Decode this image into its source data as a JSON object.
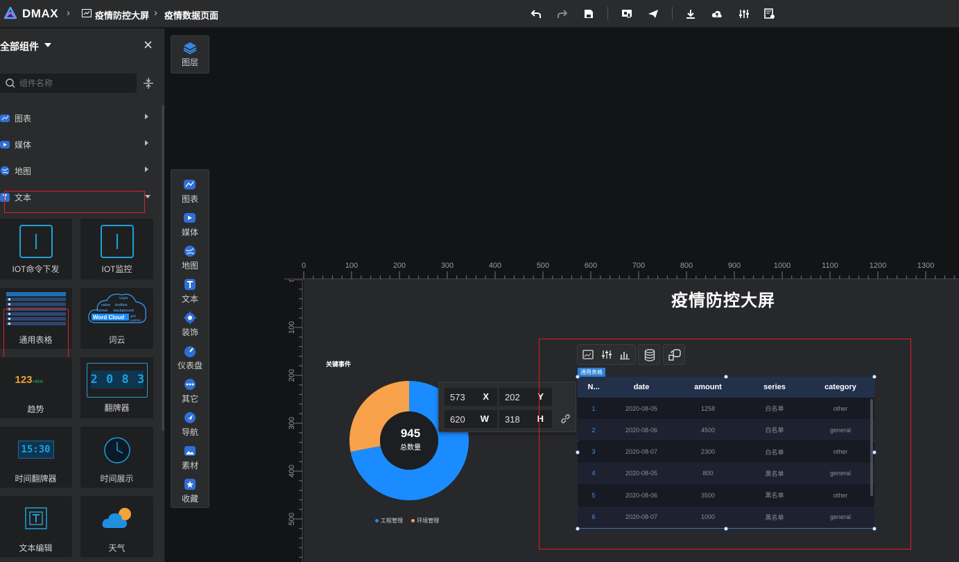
{
  "app": {
    "name": "DMAX",
    "accent": "#1a8cff"
  },
  "breadcrumb": [
    {
      "label": "疫情防控大屏"
    },
    {
      "label": "疫情数据页面"
    }
  ],
  "toolbar": {
    "buttons": [
      "undo-icon",
      "redo-icon",
      "save-icon",
      "preview-icon",
      "publish-icon",
      "download-icon",
      "upload-cloud-icon",
      "sliders-icon",
      "page-settings-icon"
    ]
  },
  "left_panel": {
    "title": "全部组件",
    "search_placeholder": "组件名称",
    "categories": [
      {
        "label": "图表",
        "expanded": false
      },
      {
        "label": "媒体",
        "expanded": false
      },
      {
        "label": "地图",
        "expanded": false
      },
      {
        "label": "文本",
        "expanded": true
      }
    ],
    "components": [
      {
        "label": "IOT命令下发"
      },
      {
        "label": "IOT监控"
      },
      {
        "label": "通用表格"
      },
      {
        "label": "词云"
      },
      {
        "label": "趋势"
      },
      {
        "label": "翻牌器"
      },
      {
        "label": "时间翻牌器"
      },
      {
        "label": "时间展示"
      },
      {
        "label": "文本编辑"
      },
      {
        "label": "天气"
      }
    ],
    "thumb_text": {
      "trend_value": "123",
      "trend_pct": "+45%",
      "flip_digits": "2 0 8 3 5",
      "time_digits": "15:30",
      "word_cloud_main": "Word Cloud",
      "word_cloud_words": [
        "value",
        "toolbox",
        "funnel",
        "background",
        "height",
        "grid",
        "position"
      ]
    }
  },
  "dock": {
    "layers_label": "图层",
    "items": [
      {
        "label": "图表"
      },
      {
        "label": "媒体"
      },
      {
        "label": "地图"
      },
      {
        "label": "文本"
      },
      {
        "label": "装饰"
      },
      {
        "label": "仪表盘"
      },
      {
        "label": "其它"
      },
      {
        "label": "导航"
      },
      {
        "label": "素材"
      },
      {
        "label": "收藏"
      }
    ]
  },
  "ruler": {
    "h_ticks": [
      "0",
      "100",
      "200",
      "300",
      "400",
      "500",
      "600",
      "700",
      "800",
      "900",
      "1000",
      "1100",
      "1200",
      "1300"
    ],
    "v_ticks": [
      "0",
      "100",
      "200",
      "300",
      "400",
      "500"
    ]
  },
  "canvas": {
    "title": "疫情防控大屏",
    "donut": {
      "title": "关键事件",
      "total_value": "945",
      "total_label": "总数量",
      "legend": [
        {
          "name": "工程管理",
          "color": "#1a8cff"
        },
        {
          "name": "环境管理",
          "color": "#f7a24a"
        }
      ]
    },
    "table": {
      "tag": "通用表格",
      "columns": [
        "N...",
        "date",
        "amount",
        "series",
        "category"
      ],
      "rows": [
        [
          "1",
          "2020-08-05",
          "1258",
          "白名单",
          "other"
        ],
        [
          "2",
          "2020-08-06",
          "4500",
          "白名单",
          "general"
        ],
        [
          "3",
          "2020-08-07",
          "2300",
          "白名单",
          "other"
        ],
        [
          "4",
          "2020-08-05",
          "800",
          "黑名单",
          "general"
        ],
        [
          "5",
          "2020-08-06",
          "3500",
          "黑名单",
          "other"
        ],
        [
          "6",
          "2020-08-07",
          "1000",
          "黑名单",
          "general"
        ]
      ]
    }
  },
  "position_popover": {
    "x": "573",
    "x_label": "X",
    "y": "202",
    "y_label": "Y",
    "w": "620",
    "w_label": "W",
    "h": "318",
    "h_label": "H"
  },
  "chart_data": {
    "type": "pie",
    "title": "关键事件",
    "center_value": 945,
    "center_label": "总数量",
    "categories": [
      "工程管理",
      "环境管理"
    ],
    "values": [
      0.72,
      0.28
    ],
    "colors": [
      "#1a8cff",
      "#f7a24a"
    ],
    "legend": "bottom"
  }
}
